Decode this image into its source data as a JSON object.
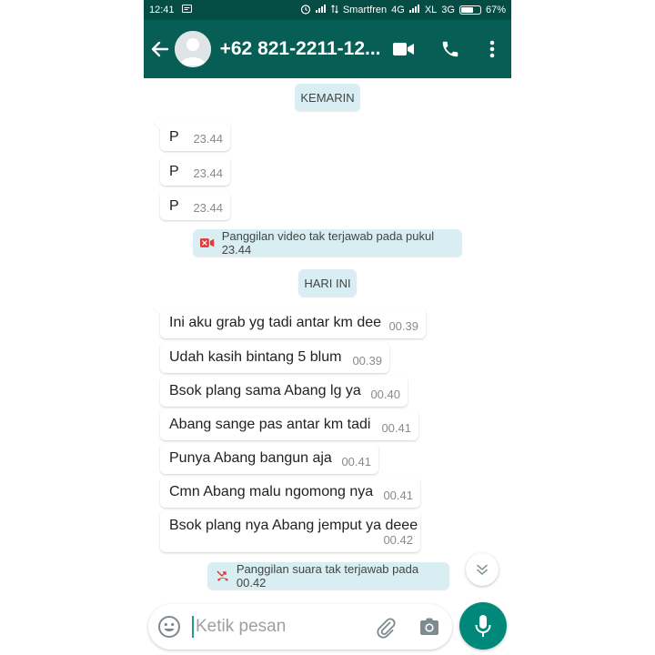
{
  "status_bar": {
    "time": "12:41",
    "carrier1": "Smartfren",
    "carrier1_net": "4G",
    "carrier2": "XL",
    "carrier2_net": "3G",
    "battery_text": "67%",
    "battery_level": 0.67
  },
  "header": {
    "contact_name": "+62 821-2211-12..."
  },
  "chat": {
    "date_yesterday": "KEMARIN",
    "date_today": "HARI INI",
    "messages_yesterday": [
      {
        "text": "P",
        "time": "23.44"
      },
      {
        "text": "P",
        "time": "23.44"
      },
      {
        "text": "P",
        "time": "23.44"
      }
    ],
    "missed_video": "Panggilan video tak terjawab pada pukul 23.44",
    "messages_today": [
      {
        "text": "Ini aku grab yg tadi antar km dee",
        "time": "00.39"
      },
      {
        "text": "Udah kasih bintang 5 blum",
        "time": "00.39"
      },
      {
        "text": "Bsok plang sama Abang lg ya",
        "time": "00.40"
      },
      {
        "text": "Abang sange pas antar km tadi",
        "time": "00.41"
      },
      {
        "text": "Punya Abang bangun aja",
        "time": "00.41"
      },
      {
        "text": "Cmn Abang malu ngomong nya",
        "time": "00.41"
      },
      {
        "text": "Bsok plang nya Abang jemput ya deee",
        "time": "00.42"
      }
    ],
    "missed_voice": "Panggilan suara tak terjawab pada 00.42"
  },
  "input": {
    "placeholder": "Ketik pesan"
  },
  "colors": {
    "header": "#075e54",
    "status_bar": "#054d44",
    "system_bubble": "#d8eef2",
    "fab": "#00897b",
    "missed_call": "#e53935"
  }
}
